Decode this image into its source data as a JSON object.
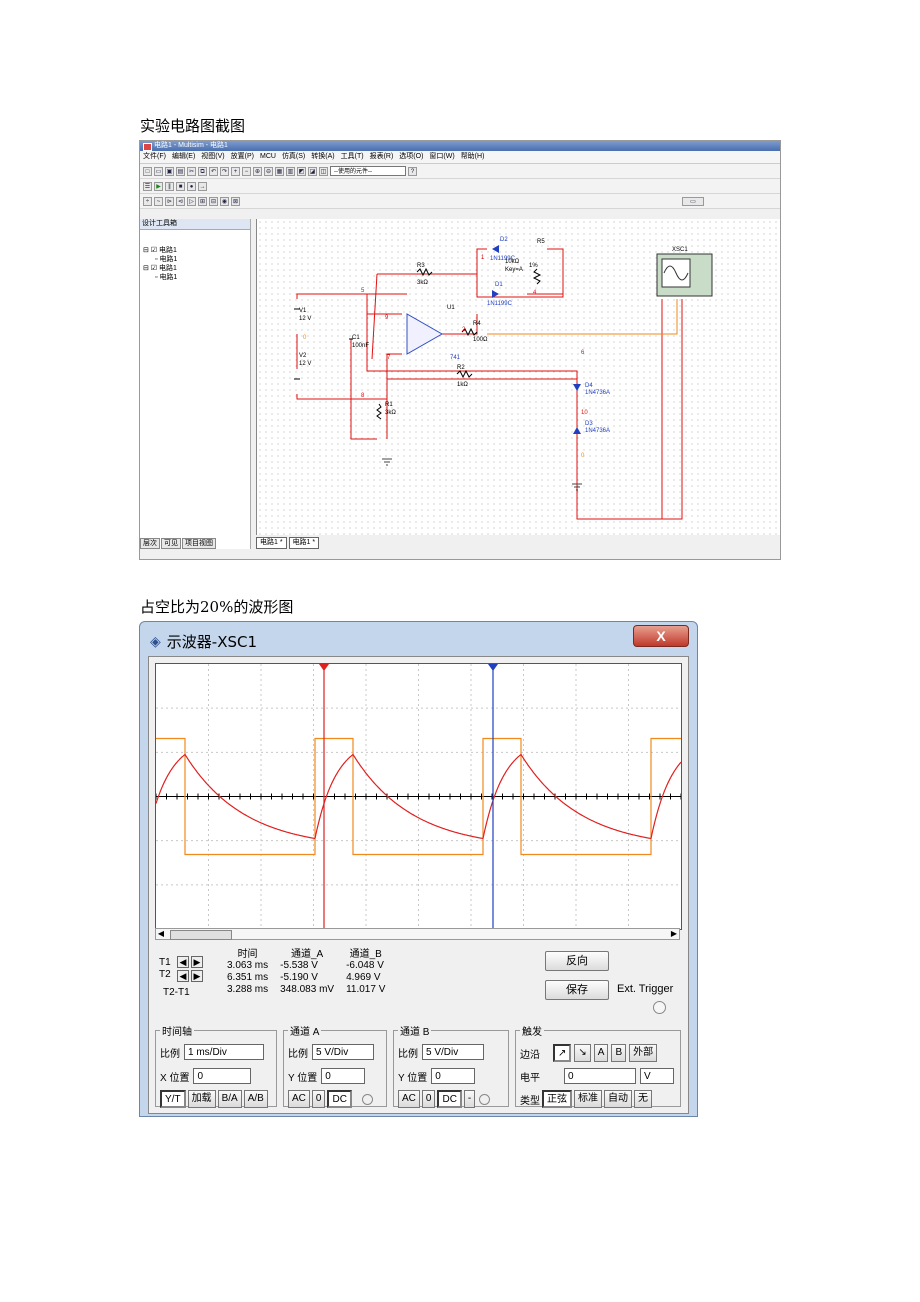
{
  "captions": {
    "circuit": "实验电路图截图",
    "waveform": "占空比为20%的波形图"
  },
  "multisim": {
    "title": "电路1 - Multisim - 电路1",
    "menu": [
      "文件(F)",
      "编辑(E)",
      "视图(V)",
      "放置(P)",
      "MCU",
      "仿真(S)",
      "转换(A)",
      "工具(T)",
      "报表(R)",
      "选项(O)",
      "窗口(W)",
      "帮助(H)"
    ],
    "component_combo": "--使用的元件--",
    "design_toolbox_title": "设计工具箱",
    "tree": [
      "电路1",
      "电路1",
      "电路1",
      "电路1"
    ],
    "panel_tabs": [
      "层次",
      "可见",
      "项目视图"
    ],
    "canvas_tabs": [
      "电路1 *",
      "电路1 *"
    ],
    "components": {
      "v1": "V1",
      "v1_val": "12 V",
      "v2": "V2",
      "v2_val": "12 V",
      "c1": "C1",
      "c1_val": "100nF",
      "r1": "R1",
      "r1_val": "3kΩ",
      "r2": "R2",
      "r2_val": "1kΩ",
      "r3": "R3",
      "r3_val": "3kΩ",
      "r4": "R4",
      "r4_val": "100Ω",
      "r5": "R5",
      "r5_val": "10kΩ",
      "r5_key": "Key=A",
      "r5_pct": "1%",
      "d1": "D1",
      "d1_val": "1N1199C",
      "d2": "D2",
      "d2_val": "1N1199C",
      "d3": "D3",
      "d3_val": "1N4736A",
      "d4": "D4",
      "d4_val": "1N4736A",
      "u1": "U1",
      "u1_val": "741",
      "xsc": "XSC1",
      "nets": [
        "1",
        "2",
        "4",
        "5",
        "6",
        "7",
        "8",
        "9",
        "10",
        "0",
        "0"
      ]
    }
  },
  "oscilloscope": {
    "title": "示波器-XSC1",
    "close_label": "X",
    "headers": [
      "时间",
      "通道_A",
      "通道_B"
    ],
    "rows": [
      {
        "label": "T1",
        "time": "3.063 ms",
        "a": "-5.538 V",
        "b": "-6.048 V"
      },
      {
        "label": "T2",
        "time": "6.351 ms",
        "a": "-5.190 V",
        "b": "4.969 V"
      },
      {
        "label": "T2-T1",
        "time": "3.288 ms",
        "a": "348.083 mV",
        "b": "11.017 V"
      }
    ],
    "reverse_btn": "反向",
    "save_btn": "保存",
    "ext_trigger": "Ext. Trigger",
    "timebase": {
      "legend": "时间轴",
      "scale_label": "比例",
      "scale": "1 ms/Div",
      "pos_label": "X 位置",
      "pos": "0",
      "modes": [
        "Y/T",
        "加载",
        "B/A",
        "A/B"
      ]
    },
    "channel_a": {
      "legend": "通道 A",
      "scale_label": "比例",
      "scale": "5 V/Div",
      "pos_label": "Y 位置",
      "pos": "0",
      "couplings": [
        "AC",
        "0",
        "DC"
      ]
    },
    "channel_b": {
      "legend": "通道 B",
      "scale_label": "比例",
      "scale": "5 V/Div",
      "pos_label": "Y 位置",
      "pos": "0",
      "couplings": [
        "AC",
        "0",
        "DC",
        "-"
      ]
    },
    "trigger": {
      "legend": "触发",
      "edge_label": "边沿",
      "edge_buttons": [
        "↗",
        "↘",
        "A",
        "B",
        "外部"
      ],
      "level_label": "电平",
      "level": "0",
      "level_unit": "V",
      "type_label": "类型",
      "types": [
        "正弦",
        "标准",
        "自动",
        "无"
      ]
    },
    "colors": {
      "channel_a": "#e02020",
      "channel_b": "#f08a1c",
      "cursor1": "#e02020",
      "cursor2": "#2040c0"
    }
  }
}
